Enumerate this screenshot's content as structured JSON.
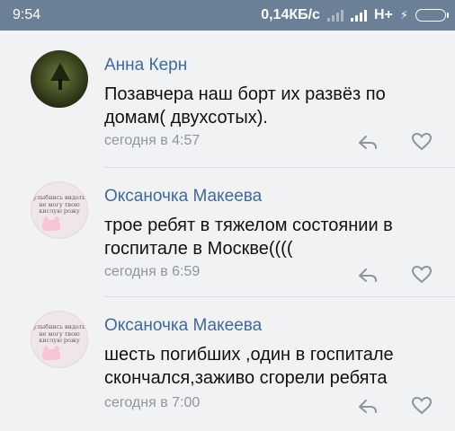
{
  "status_bar": {
    "time": "9:54",
    "network_speed": "0,14КБ/с",
    "network_type": "H+"
  },
  "comments": [
    {
      "author": "Анна Керн",
      "text": "Позавчера наш борт их развёз по домам( двухсотых).",
      "time": "сегодня в 4:57",
      "avatar": "forest-avatar"
    },
    {
      "author": "Оксаночка Макеева",
      "text": "трое ребят в тяжелом состоянии в госпитале в Москве((((",
      "time": "сегодня в 6:59",
      "avatar": "cat-avatar",
      "avatar_text": "улыбнись видеть не могу твою кислую рожу"
    },
    {
      "author": "Оксаночка Макеева",
      "text": "шесть погибших ,один в госпитале скончался,заживо сгорели ребята",
      "time": "сегодня в 7:00",
      "avatar": "cat-avatar",
      "avatar_text": "улыбнись видеть не могу твою кислую рожу"
    }
  ],
  "colors": {
    "status_bar": "#6b7f96",
    "background": "#f1f2f4",
    "author": "#3f6a9b",
    "meta": "#8d959e"
  },
  "icons": [
    "reply-icon",
    "heart-icon",
    "signal-icon",
    "battery-icon"
  ]
}
